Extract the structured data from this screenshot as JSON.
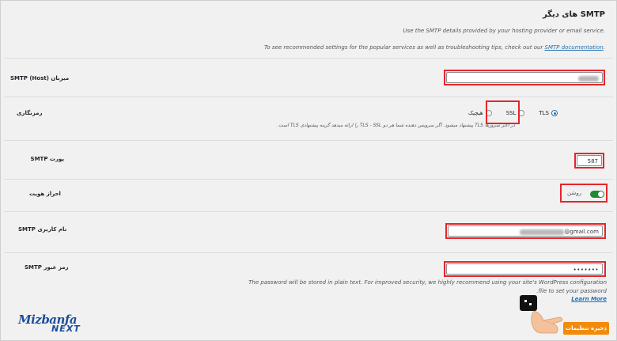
{
  "section": {
    "title": "SMTP های دیگر",
    "desc1": "Use the SMTP details provided by your hosting provider or email service.",
    "desc2_prefix": "To see recommended settings for the popular services as well as troubleshooting tips, check out our",
    "desc2_link": "SMTP documentation",
    "desc2_suffix": "."
  },
  "host": {
    "label": "میزبان SMTP (Host)",
    "value": "mail"
  },
  "encryption": {
    "label": "رمزنگاری",
    "options": [
      {
        "label": "هیچیک",
        "selected": false
      },
      {
        "label": "SSL",
        "selected": false
      },
      {
        "label": "TLS",
        "selected": true
      }
    ],
    "help": "در اکثر سرورها TLS پیشنهاد میشود. اگر سرویس دهنده شما هر دو TLS - SSL را ارائه میدهد گزینه پیشنهادی TLS است."
  },
  "port": {
    "label": "پورت SMTP",
    "value": "587"
  },
  "auth": {
    "label": "احراز هویت",
    "state_label": "روشن",
    "enabled": true
  },
  "username": {
    "label": "نام کاربری SMTP",
    "suffix": "@gmail.com"
  },
  "password": {
    "label": "رمز عبور SMTP",
    "value": "•••••••",
    "note1": "The password will be stored in plain text. For improved security, we highly recommend using your site's WordPress configuration",
    "note2": "file to set your password.",
    "learn_more": "Learn More"
  },
  "save_label": "ذخیره تنظیمات",
  "logo": {
    "top": "Mizbanfa",
    "bottom": "NEXT"
  },
  "colors": {
    "highlight": "#e5262a",
    "accent": "#2271b1",
    "toggle_on": "#1e8a33",
    "save": "#f28b0a"
  }
}
